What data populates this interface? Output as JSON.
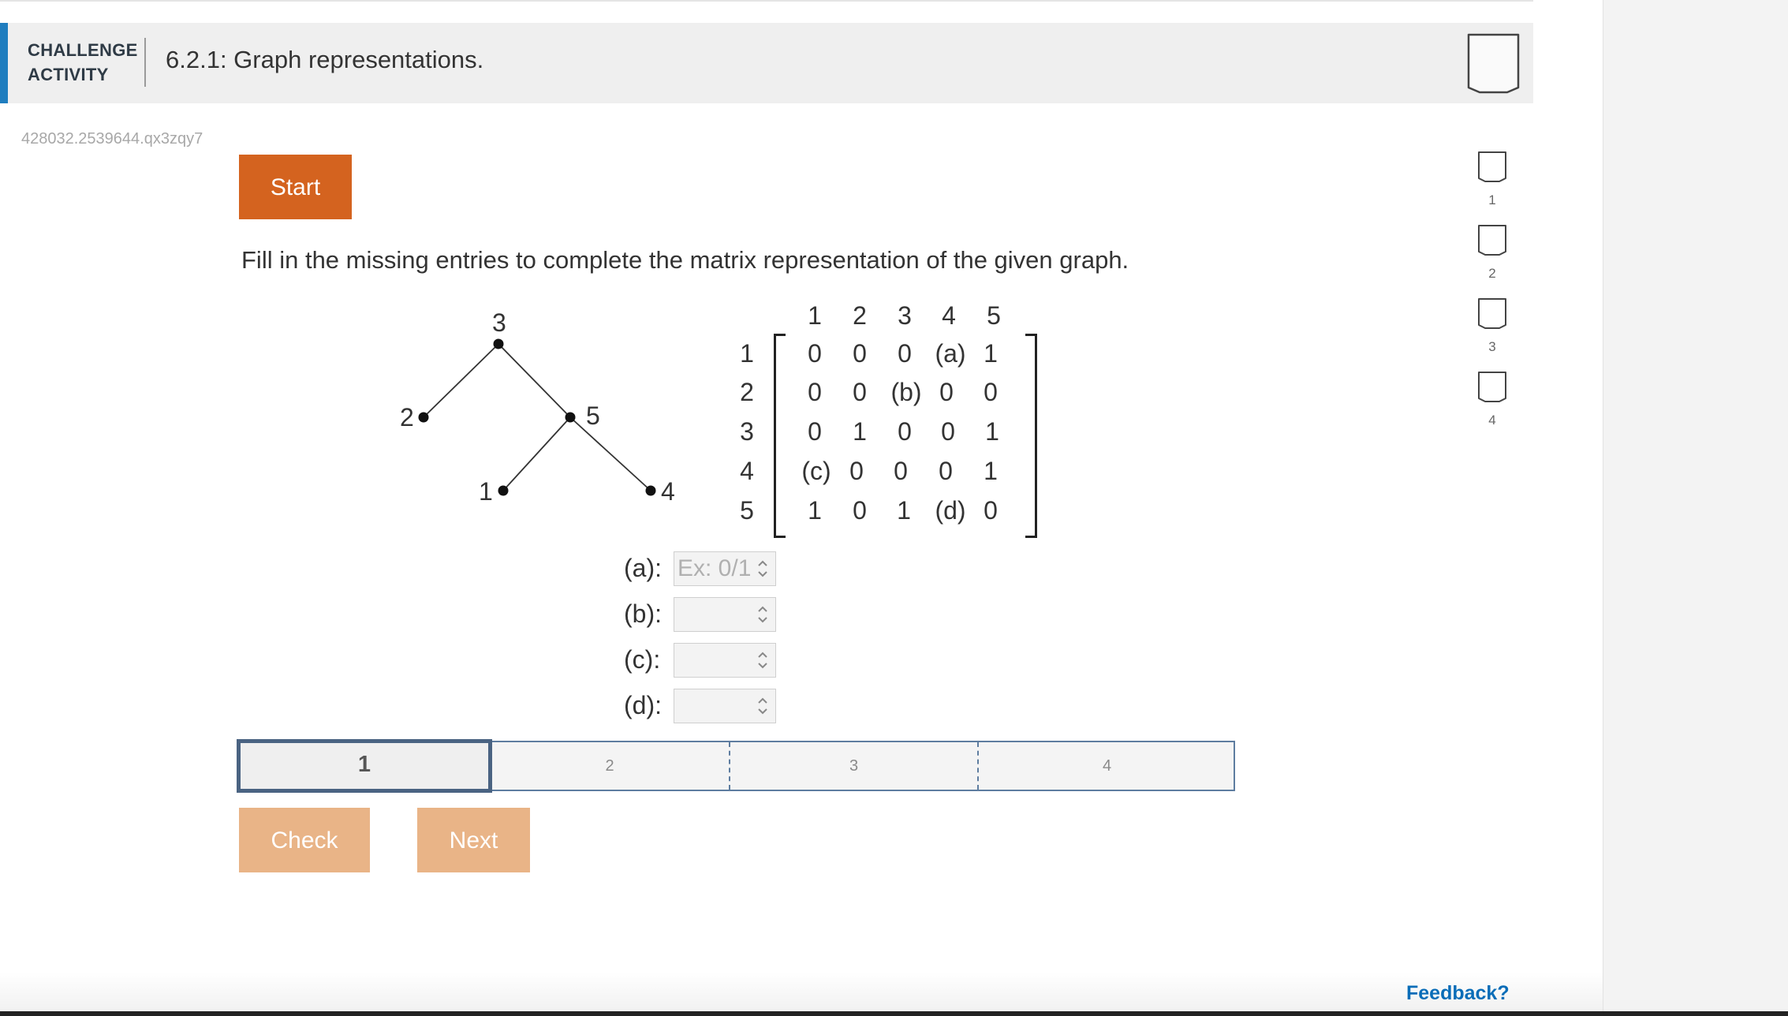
{
  "header": {
    "kind_line1": "CHALLENGE",
    "kind_line2": "ACTIVITY",
    "title": "6.2.1: Graph representations."
  },
  "activity_id": "428032.2539644.qx3zqy7",
  "buttons": {
    "start": "Start",
    "check": "Check",
    "next": "Next"
  },
  "instruction": "Fill in the missing entries to complete the matrix representation of the given graph.",
  "graph": {
    "vertices": [
      "3",
      "2",
      "5",
      "1",
      "4"
    ]
  },
  "matrix": {
    "col_headers": [
      "1",
      "2",
      "3",
      "4",
      "5"
    ],
    "row_headers": [
      "1",
      "2",
      "3",
      "4",
      "5"
    ],
    "rows": [
      [
        "0",
        "0",
        "0",
        "(a)",
        "1"
      ],
      [
        "0",
        "0",
        "(b)",
        "0",
        "0"
      ],
      [
        "0",
        "1",
        "0",
        "0",
        "1"
      ],
      [
        "(c)",
        "0",
        "0",
        "0",
        "1"
      ],
      [
        "1",
        "0",
        "1",
        "(d)",
        "0"
      ]
    ]
  },
  "answers": [
    {
      "label": "(a):",
      "placeholder": "Ex: 0/1",
      "value": ""
    },
    {
      "label": "(b):",
      "placeholder": "",
      "value": ""
    },
    {
      "label": "(c):",
      "placeholder": "",
      "value": ""
    },
    {
      "label": "(d):",
      "placeholder": "",
      "value": ""
    }
  ],
  "progress": {
    "levels": [
      "1",
      "2",
      "3",
      "4"
    ],
    "current": "1"
  },
  "side_levels": [
    "1",
    "2",
    "3",
    "4"
  ],
  "feedback_link": "Feedback?",
  "colors": {
    "accent_blue": "#1f7dbf",
    "start_orange": "#d4631f",
    "disabled_orange": "#e9b487",
    "progress_border": "#5e7da0",
    "feedback_blue": "#0a6db8"
  }
}
